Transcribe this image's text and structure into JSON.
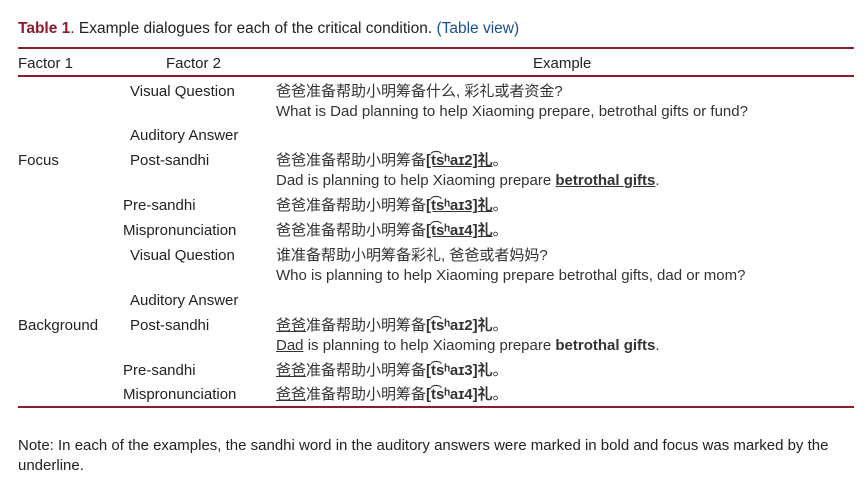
{
  "caption": {
    "label": "Table 1",
    "text": ". Example dialogues for each of the critical condition. ",
    "link": "(Table view)"
  },
  "headers": {
    "factor1": "Factor 1",
    "factor2": "Factor 2",
    "example": "Example"
  },
  "focus": {
    "factor1": "Focus",
    "visual_question": {
      "label": "Visual Question",
      "zh": "爸爸准备帮助小明筹备什么, 彩礼或者资金?",
      "en": "What is Dad planning to help Xiaoming prepare, betrothal gifts or fund?"
    },
    "auditory_answer": {
      "label": "Auditory Answer"
    },
    "post_sandhi": {
      "label": "Post-sandhi",
      "zh_prefix": "爸爸准备帮助小明筹备",
      "zh_ipa": "[t͡sʰaɪ2]",
      "zh_char": "礼",
      "zh_end": "。",
      "en_prefix": "Dad is planning to help Xiaoming prepare ",
      "en_bold": "betrothal gifts",
      "en_end": "."
    },
    "pre_sandhi": {
      "label": "Pre-sandhi",
      "zh_prefix": "爸爸准备帮助小明筹备",
      "zh_ipa": "[t͡sʰaɪ3]",
      "zh_char": "礼",
      "zh_end": "。"
    },
    "mispronunciation": {
      "label": "Mispronunciation",
      "zh_prefix": "爸爸准备帮助小明筹备",
      "zh_ipa": "[t͡sʰaɪ4]",
      "zh_char": "礼",
      "zh_end": "。"
    }
  },
  "background": {
    "factor1": "Background",
    "visual_question": {
      "label": "Visual Question",
      "zh": "谁准备帮助小明筹备彩礼, 爸爸或者妈妈?",
      "en": "Who is planning to help Xiaoming prepare betrothal gifts, dad or mom?"
    },
    "auditory_answer": {
      "label": "Auditory Answer"
    },
    "post_sandhi": {
      "label": "Post-sandhi",
      "zh_focus": "爸爸",
      "zh_rest": "准备帮助小明筹备",
      "zh_ipa": "[t͡sʰaɪ2]",
      "zh_char": "礼",
      "zh_end": "。",
      "en_focus": "Dad",
      "en_mid": " is planning to help Xiaoming prepare ",
      "en_bold": "betrothal gifts",
      "en_end": "."
    },
    "pre_sandhi": {
      "label": "Pre-sandhi",
      "zh_focus": "爸爸",
      "zh_rest": "准备帮助小明筹备",
      "zh_ipa": "[t͡sʰaɪ3]",
      "zh_char": "礼",
      "zh_end": "。"
    },
    "mispronunciation": {
      "label": "Mispronunciation",
      "zh_focus": "爸爸",
      "zh_rest": "准备帮助小明筹备",
      "zh_ipa": "[t͡sʰaɪ4]",
      "zh_char": "礼",
      "zh_end": "。"
    }
  },
  "note": "Note: In each of the examples, the sandhi word in the auditory answers were marked in bold and focus was marked by the underline.",
  "colors": {
    "rule": "#8b1c2c",
    "caption_label": "#8b1c2c",
    "link": "#1a4f8f"
  }
}
